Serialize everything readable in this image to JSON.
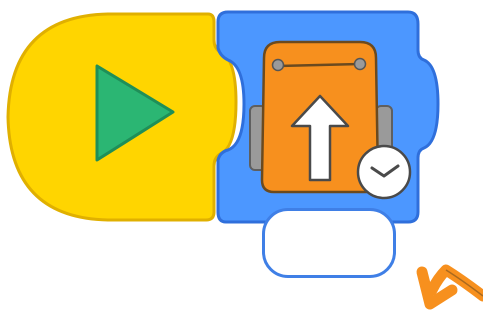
{
  "blocks": {
    "trigger": {
      "name": "start-on-green-flag",
      "fill": "#ffd500",
      "stroke": "#e0b000",
      "icon": "play-icon",
      "icon_color": "#2bb673"
    },
    "action": {
      "name": "move-forward-block",
      "fill": "#4c97ff",
      "stroke": "#2f6fdb",
      "icon": "robot-up-arrow-icon",
      "robot_color": "#f7901e",
      "arrow_color": "#ffffff",
      "badge_icon": "clock-icon",
      "parameter_value": ""
    }
  },
  "hint": {
    "icon": "curved-arrow-icon",
    "color": "#f7901e"
  }
}
